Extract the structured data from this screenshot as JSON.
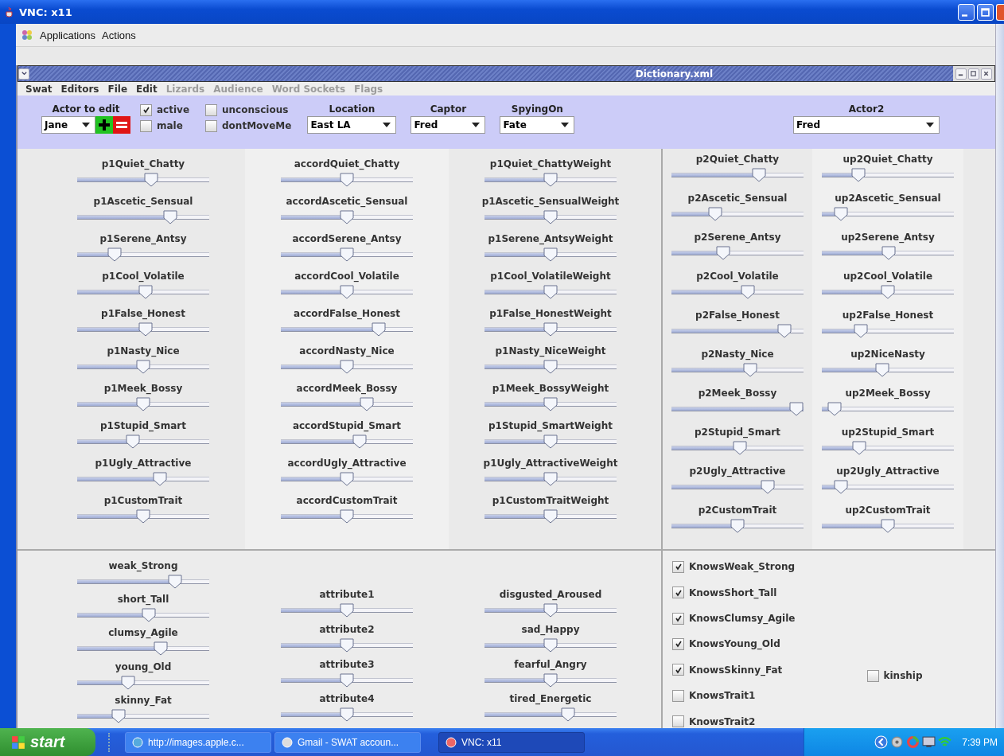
{
  "window": {
    "title": "VNC: x11"
  },
  "app_menu": [
    "Applications",
    "Actions"
  ],
  "frame": {
    "title": "Dictionary.xml"
  },
  "menu": [
    {
      "label": "Swat",
      "disabled": false
    },
    {
      "label": "Editors",
      "disabled": false
    },
    {
      "label": "File",
      "disabled": false
    },
    {
      "label": "Edit",
      "disabled": false
    },
    {
      "label": "Lizards",
      "disabled": true
    },
    {
      "label": "Audience",
      "disabled": true
    },
    {
      "label": "Word Sockets",
      "disabled": true
    },
    {
      "label": "Flags",
      "disabled": true
    }
  ],
  "toolbar": {
    "actor": {
      "label": "Actor to edit",
      "value": "Jane"
    },
    "flags": [
      {
        "label": "active",
        "checked": true
      },
      {
        "label": "male",
        "checked": false
      },
      {
        "label": "unconscious",
        "checked": false
      },
      {
        "label": "dontMoveMe",
        "checked": false
      }
    ],
    "selects": [
      {
        "label": "Location",
        "value": "East LA"
      },
      {
        "label": "Captor",
        "value": "Fred"
      },
      {
        "label": "SpyingOn",
        "value": "Fate"
      }
    ],
    "actor2": {
      "label": "Actor2",
      "value": "Fred"
    }
  },
  "upper_left": [
    {
      "sliders": [
        {
          "label": "p1Quiet_Chatty",
          "level": 0.57
        },
        {
          "label": "p1Ascetic_Sensual",
          "level": 0.73
        },
        {
          "label": "p1Serene_Antsy",
          "level": 0.26
        },
        {
          "label": "p1Cool_Volatile",
          "level": 0.52
        },
        {
          "label": "p1False_Honest",
          "level": 0.52
        },
        {
          "label": "p1Nasty_Nice",
          "level": 0.5
        },
        {
          "label": "p1Meek_Bossy",
          "level": 0.5
        },
        {
          "label": "p1Stupid_Smart",
          "level": 0.41
        },
        {
          "label": "p1Ugly_Attractive",
          "level": 0.64
        },
        {
          "label": "p1CustomTrait",
          "level": 0.5
        }
      ]
    },
    {
      "sliders": [
        {
          "label": "accordQuiet_Chatty",
          "level": 0.5
        },
        {
          "label": "accordAscetic_Sensual",
          "level": 0.5
        },
        {
          "label": "accordSerene_Antsy",
          "level": 0.5
        },
        {
          "label": "accordCool_Volatile",
          "level": 0.5
        },
        {
          "label": "accordFalse_Honest",
          "level": 0.77
        },
        {
          "label": "accordNasty_Nice",
          "level": 0.5
        },
        {
          "label": "accordMeek_Bossy",
          "level": 0.67
        },
        {
          "label": "accordStupid_Smart",
          "level": 0.61
        },
        {
          "label": "accordUgly_Attractive",
          "level": 0.5
        },
        {
          "label": "accordCustomTrait",
          "level": 0.5
        }
      ]
    },
    {
      "sliders": [
        {
          "label": "p1Quiet_ChattyWeight",
          "level": 0.5
        },
        {
          "label": "p1Ascetic_SensualWeight",
          "level": 0.5
        },
        {
          "label": "p1Serene_AntsyWeight",
          "level": 0.5
        },
        {
          "label": "p1Cool_VolatileWeight",
          "level": 0.5
        },
        {
          "label": "p1False_HonestWeight",
          "level": 0.5
        },
        {
          "label": "p1Nasty_NiceWeight",
          "level": 0.5
        },
        {
          "label": "p1Meek_BossyWeight",
          "level": 0.5
        },
        {
          "label": "p1Stupid_SmartWeight",
          "level": 0.5
        },
        {
          "label": "p1Ugly_AttractiveWeight",
          "level": 0.5
        },
        {
          "label": "p1CustomTraitWeight",
          "level": 0.5
        }
      ]
    }
  ],
  "upper_right": [
    {
      "sliders": [
        {
          "label": "p2Quiet_Chatty",
          "level": 0.68
        },
        {
          "label": "p2Ascetic_Sensual",
          "level": 0.31
        },
        {
          "label": "p2Serene_Antsy",
          "level": 0.38
        },
        {
          "label": "p2Cool_Volatile",
          "level": 0.59
        },
        {
          "label": "p2False_Honest",
          "level": 0.9
        },
        {
          "label": "p2Nasty_Nice",
          "level": 0.61
        },
        {
          "label": "p2Meek_Bossy",
          "level": 1
        },
        {
          "label": "p2Stupid_Smart",
          "level": 0.52
        },
        {
          "label": "p2Ugly_Attractive",
          "level": 0.76
        },
        {
          "label": "p2CustomTrait",
          "level": 0.5
        }
      ]
    },
    {
      "sliders": [
        {
          "label": "up2Quiet_Chatty",
          "level": 0.25
        },
        {
          "label": "up2Ascetic_Sensual",
          "level": 0.1
        },
        {
          "label": "up2Serene_Antsy",
          "level": 0.51
        },
        {
          "label": "up2Cool_Volatile",
          "level": 0.5
        },
        {
          "label": "up2False_Honest",
          "level": 0.27
        },
        {
          "label": "up2NiceNasty",
          "level": 0.45
        },
        {
          "label": "up2Meek_Bossy",
          "level": 0.05
        },
        {
          "label": "up2Stupid_Smart",
          "level": 0.26
        },
        {
          "label": "up2Ugly_Attractive",
          "level": 0.1
        },
        {
          "label": "up2CustomTrait",
          "level": 0.5
        }
      ]
    }
  ],
  "lower": [
    {
      "sliders": [
        {
          "label": "weak_Strong",
          "level": 0.77
        },
        {
          "label": "short_Tall",
          "level": 0.55
        },
        {
          "label": "clumsy_Agile",
          "level": 0.65
        },
        {
          "label": "young_Old",
          "level": 0.37
        },
        {
          "label": "skinny_Fat",
          "level": 0.29
        }
      ]
    },
    {
      "sliders": [
        {
          "label": "attribute1",
          "level": 0.5
        },
        {
          "label": "attribute2",
          "level": 0.5
        },
        {
          "label": "attribute3",
          "level": 0.5
        },
        {
          "label": "attribute4",
          "level": 0.5
        }
      ]
    },
    {
      "sliders": [
        {
          "label": "disgusted_Aroused",
          "level": 0.5
        },
        {
          "label": "sad_Happy",
          "level": 0.5
        },
        {
          "label": "fearful_Angry",
          "level": 0.5
        },
        {
          "label": "tired_Energetic",
          "level": 0.65
        }
      ]
    }
  ],
  "knows": [
    {
      "label": "KnowsWeak_Strong",
      "checked": true
    },
    {
      "label": "KnowsShort_Tall",
      "checked": true
    },
    {
      "label": "KnowsClumsy_Agile",
      "checked": true
    },
    {
      "label": "KnowsYoung_Old",
      "checked": true
    },
    {
      "label": "KnowsSkinny_Fat",
      "checked": true
    },
    {
      "label": "KnowsTrait1",
      "checked": false
    },
    {
      "label": "KnowsTrait2",
      "checked": false
    }
  ],
  "kinship": {
    "label": "kinship",
    "checked": false
  },
  "taskbar": {
    "start": "start",
    "tasks": [
      {
        "label": "http://images.apple.c...",
        "selected": false
      },
      {
        "label": "Gmail - SWAT accoun...",
        "selected": false
      },
      {
        "label": "VNC: x11",
        "selected": true
      }
    ],
    "clock": "7:39 PM"
  }
}
